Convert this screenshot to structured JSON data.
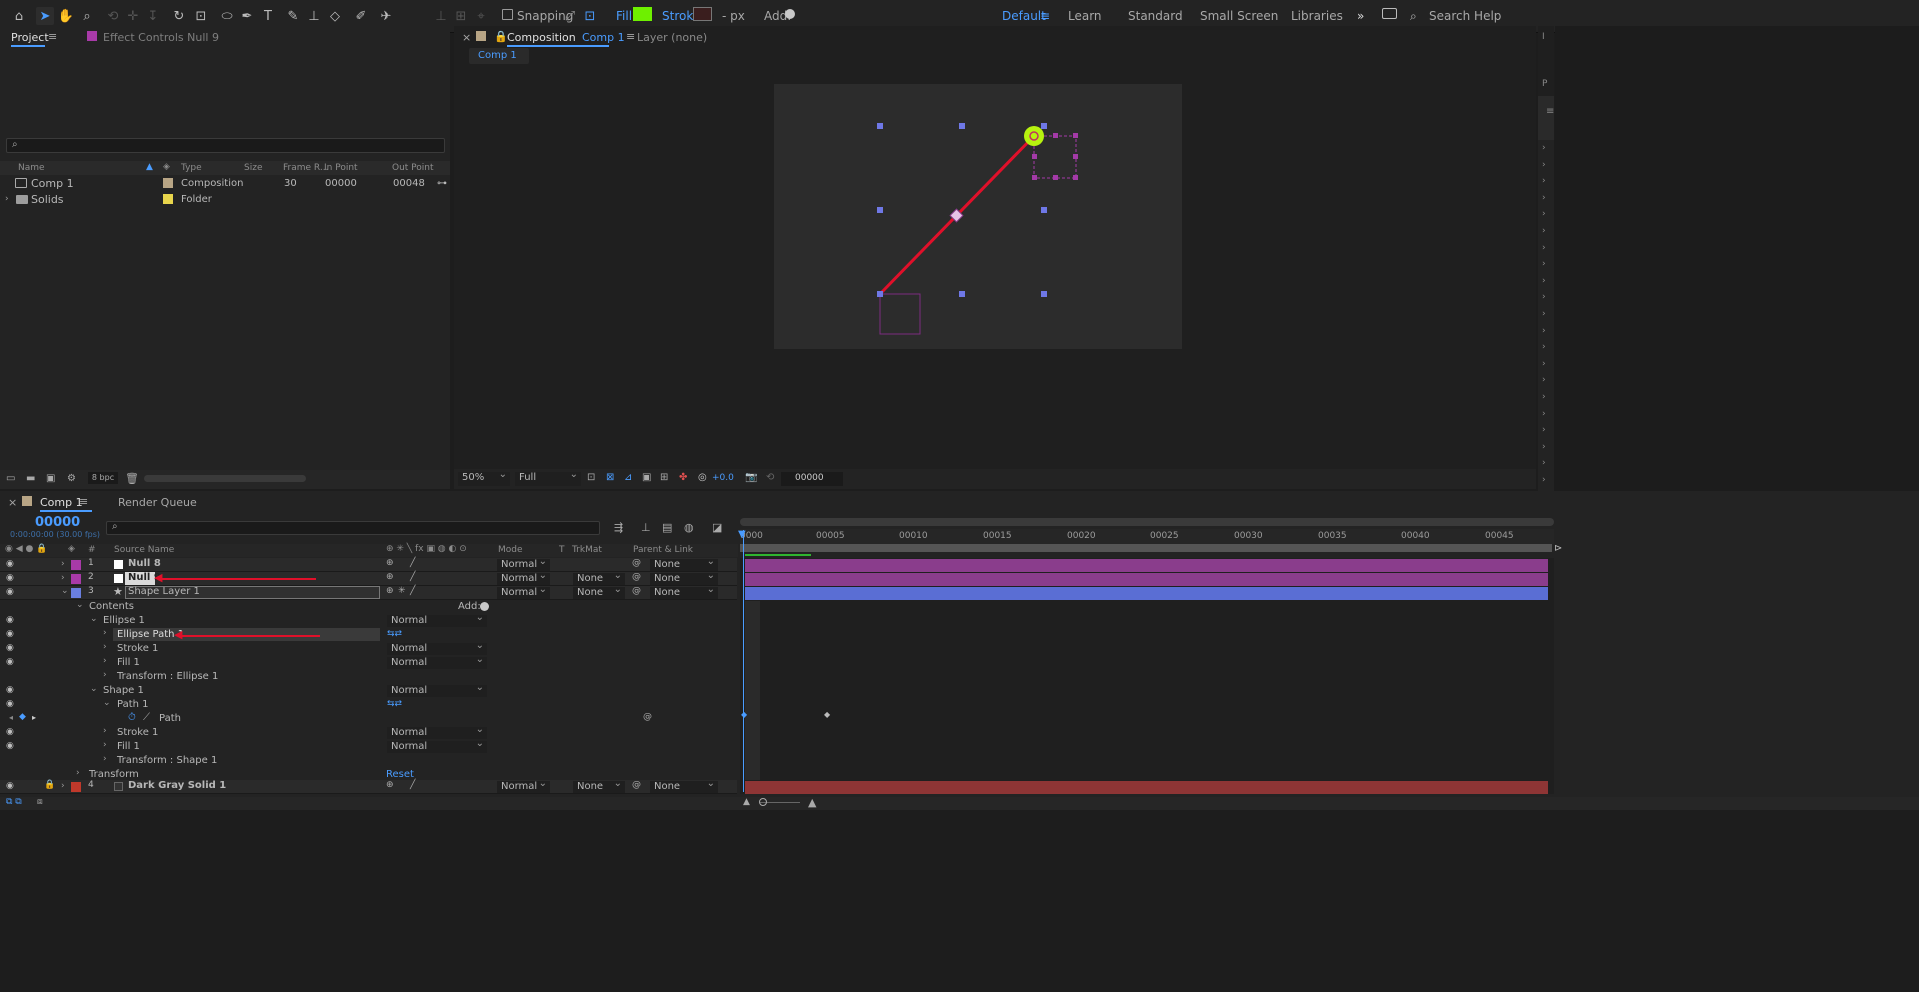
{
  "toolbar": {
    "snapping_label": "Snapping",
    "fill_label": "Fill:",
    "stroke_label": "Stroke:",
    "stroke_px": "- px",
    "add_label": "Add:",
    "fill_color": "#6ef000",
    "workspaces": [
      "Default",
      "Learn",
      "Standard",
      "Small Screen",
      "Libraries"
    ],
    "active_workspace": "Default",
    "search_placeholder": "Search Help",
    "more_label": "»"
  },
  "project_panel": {
    "tab_project": "Project",
    "tab_effect_controls": "Effect Controls Null 9",
    "columns": [
      "Name",
      "Type",
      "Size",
      "Frame R...",
      "In Point",
      "Out Point"
    ],
    "items": [
      {
        "name": "Comp 1",
        "type": "Composition",
        "size": "",
        "frame_rate": "30",
        "in_point": "00000",
        "out_point": "00048",
        "label_color": "#b8a585"
      },
      {
        "name": "Solids",
        "type": "Folder",
        "size": "",
        "frame_rate": "",
        "in_point": "",
        "out_point": "",
        "label_color": "#e8d54c"
      }
    ],
    "bpc_label": "8 bpc"
  },
  "composition_panel": {
    "tab_label": "Composition",
    "tab_comp_name": "Comp 1",
    "layer_tab": "Layer (none)",
    "breadcrumb": "Comp 1",
    "zoom": "50%",
    "resolution": "Full",
    "exposure": "+0.0",
    "timecode": "00000",
    "line_color": "#e0102a",
    "ellipse_color": "#b7f20f"
  },
  "right_strip": {
    "labels": [
      "I",
      "P"
    ]
  },
  "timeline": {
    "tab_comp": "Comp 1",
    "tab_render_queue": "Render Queue",
    "current_time": "00000",
    "fps_label": "0:00:00:00 (30.00 fps)",
    "columns": {
      "source_name": "Source Name",
      "mode": "Mode",
      "t": "T",
      "trkmat": "TrkMat",
      "parent": "Parent & Link"
    },
    "ruler_ticks": [
      "0000",
      "00005",
      "00010",
      "00015",
      "00020",
      "00025",
      "00030",
      "00035",
      "00040",
      "00045"
    ],
    "layers": [
      {
        "num": "1",
        "name": "Null 8",
        "mode": "Normal",
        "trkmat": "",
        "parent": "None",
        "label_color": "#a83aa8",
        "bar_color": "#8a3d8c"
      },
      {
        "num": "2",
        "name": "Null 9",
        "mode": "Normal",
        "trkmat": "None",
        "parent": "None",
        "label_color": "#a83aa8",
        "bar_color": "#8a3d8c"
      },
      {
        "num": "3",
        "name": "Shape Layer 1",
        "mode": "Normal",
        "trkmat": "None",
        "parent": "None",
        "label_color": "#6a7fe0",
        "bar_color": "#5a6ed4"
      },
      {
        "num": "4",
        "name": "Dark Gray Solid 1",
        "mode": "Normal",
        "trkmat": "None",
        "parent": "None",
        "label_color": "#c0392b",
        "bar_color": "#8e3535"
      }
    ],
    "contents": {
      "label": "Contents",
      "add_label": "Add:",
      "ellipse_group": "Ellipse 1",
      "ellipse_path": "Ellipse Path 1",
      "stroke1": "Stroke 1",
      "fill1": "Fill 1",
      "transform_ellipse": "Transform : Ellipse 1",
      "shape_group": "Shape 1",
      "path1": "Path 1",
      "path": "Path",
      "stroke1b": "Stroke 1",
      "fill1b": "Fill 1",
      "transform_shape": "Transform : Shape 1",
      "transform": "Transform",
      "reset": "Reset",
      "blend_mode": "Normal"
    }
  }
}
